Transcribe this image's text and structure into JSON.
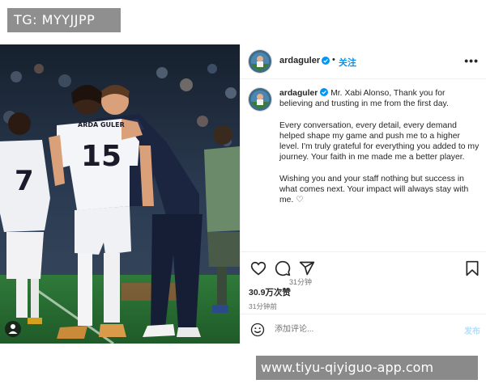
{
  "watermarks": {
    "top": "TG: MYYJJPP",
    "bottom": "www.tiyu-qiyiguo-app.com"
  },
  "header": {
    "username": "ardaguler",
    "separator": "•",
    "follow_label": "关注",
    "more_label": "•••"
  },
  "post": {
    "caption_username": "ardaguler",
    "paragraphs": [
      "Mr. Xabi Alonso, Thank you for believing and trusting in me from the first day.",
      "Every conversation, every detail, every demand helped shape my game and push me to a higher level. I'm truly grateful for everything you added to my journey. Your faith in me made me a better player.",
      "Wishing you and your staff nothing but success in what comes next. Your impact will always stay with me. ♡"
    ],
    "caption_time": "31分钟"
  },
  "photo": {
    "jersey_name": "ARDA GULER",
    "jersey_number": "15",
    "left_player_number": "7"
  },
  "engagement": {
    "likes": "30.9万次赞",
    "timestamp": "31分钟前"
  },
  "comment": {
    "placeholder": "添加评论...",
    "post_label": "发布"
  },
  "icons": [
    "heart-icon",
    "comment-icon",
    "share-icon",
    "bookmark-icon",
    "emoji-icon",
    "more-icon",
    "verified-icon",
    "user-tag-icon"
  ],
  "colors": {
    "accent": "#0095f6",
    "post_disabled": "#b2dffc",
    "text": "#262626",
    "muted": "#737373",
    "border": "#efefef"
  }
}
